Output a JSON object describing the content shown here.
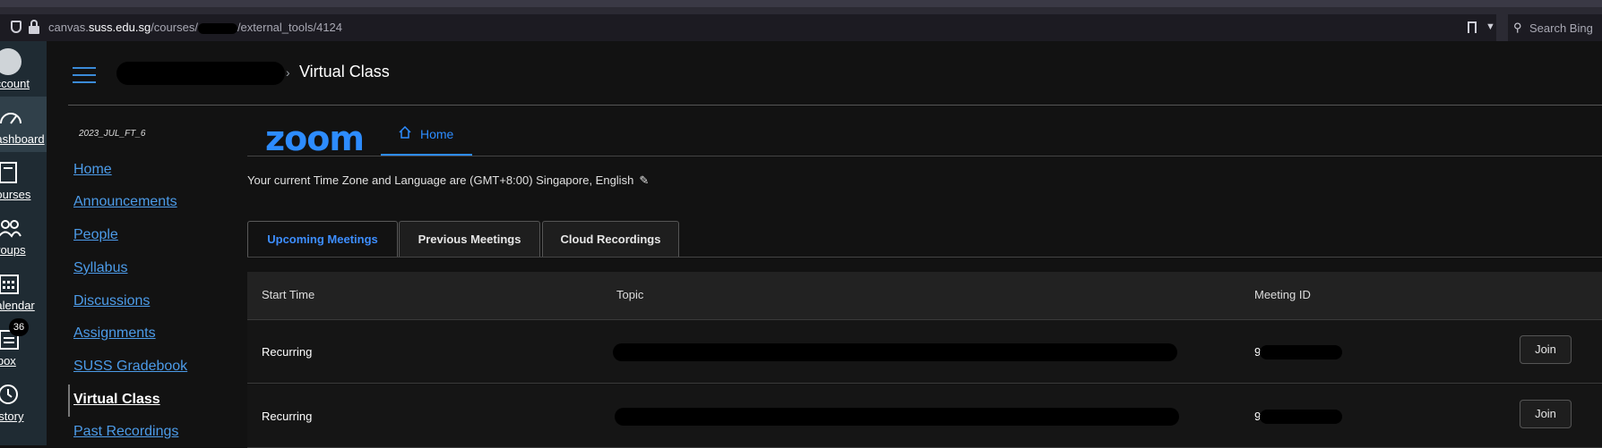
{
  "browser": {
    "url_prefix": "canvas.",
    "url_domain": "suss.edu.sg",
    "url_path_start": "/courses/",
    "url_path_end": "/external_tools/4124",
    "search_placeholder": "Search Bing"
  },
  "global_nav": {
    "items": [
      {
        "label": "Account",
        "icon": "account-icon"
      },
      {
        "label": "Dashboard",
        "icon": "dashboard-icon"
      },
      {
        "label": "Courses",
        "icon": "courses-icon"
      },
      {
        "label": "Groups",
        "icon": "groups-icon"
      },
      {
        "label": "Calendar",
        "icon": "calendar-icon"
      },
      {
        "label": "Inbox",
        "icon": "inbox-icon",
        "badge": "36"
      },
      {
        "label": "History",
        "icon": "history-icon"
      }
    ]
  },
  "header": {
    "breadcrumb_current": "Virtual Class"
  },
  "course_nav": {
    "term": "2023_JUL_FT_6",
    "items": [
      "Home",
      "Announcements",
      "People",
      "Syllabus",
      "Discussions",
      "Assignments",
      "SUSS Gradebook",
      "Virtual Class",
      "Past Recordings"
    ]
  },
  "zoom": {
    "logo": "zoom",
    "home_tab": "Home",
    "timezone_text": "Your current Time Zone and Language are (GMT+8:00) Singapore, English",
    "tabs": [
      "Upcoming Meetings",
      "Previous Meetings",
      "Cloud Recordings"
    ],
    "columns": [
      "Start Time",
      "Topic",
      "Meeting ID"
    ],
    "rows": [
      {
        "start": "Recurring",
        "meeting_id_prefix": "9",
        "join": "Join"
      },
      {
        "start": "Recurring",
        "meeting_id_prefix": "9",
        "join": "Join"
      }
    ],
    "accent": "#2d8cff"
  }
}
